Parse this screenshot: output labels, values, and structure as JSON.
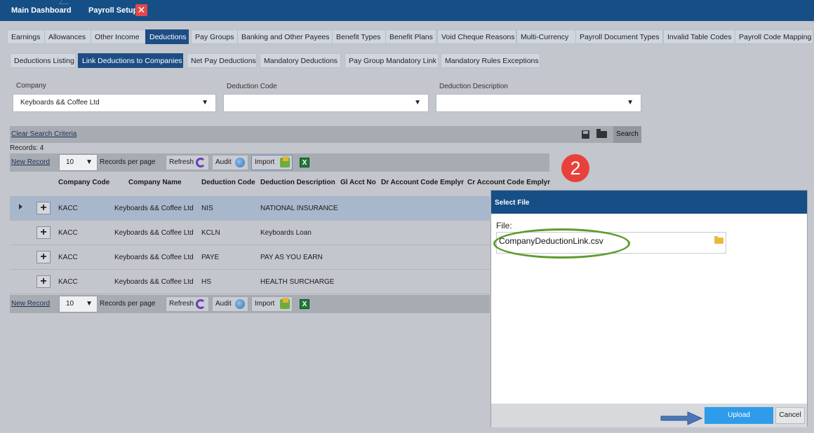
{
  "top_tabs": {
    "main": "Main Dashboard",
    "payroll": "Payroll Setup",
    "close": "✕"
  },
  "tabs_level1": [
    "Earnings",
    "Allowances",
    "Other Income",
    "Deductions",
    "Pay Groups",
    "Banking and Other Payees",
    "Benefit Types",
    "Benefit Plans",
    "Void Cheque Reasons",
    "Multi-Currency",
    "Payroll Document Types",
    "Invalid Table Codes",
    "Payroll Code Mapping"
  ],
  "tabs_level1_active": "Deductions",
  "tabs_level2": [
    "Deductions Listing",
    "Link Deductions to Companies",
    "Net Pay Deductions",
    "Mandatory Deductions",
    "Pay Group Mandatory Link",
    "Mandatory Rules Exceptions"
  ],
  "tabs_level2_active": "Link Deductions to Companies",
  "filters": {
    "company_label": "Company",
    "company_value": "Keyboards && Coffee Ltd",
    "deduction_code_label": "Deduction Code",
    "deduction_code_value": "",
    "deduction_desc_label": "Deduction Description",
    "deduction_desc_value": ""
  },
  "search_bar": {
    "clear": "Clear Search Criteria",
    "search": "Search"
  },
  "records": "Records:  4",
  "toolbar": {
    "new_record": "New Record",
    "per_page_value": "10",
    "per_page_label": "Records per page",
    "refresh": "Refresh",
    "audit": "Audit",
    "import": "Import"
  },
  "columns": [
    "Company Code",
    "Company Name",
    "Deduction Code",
    "Deduction Description",
    "Gl Acct No",
    "Dr Account Code Emplyr",
    "Cr Account Code Emplyr"
  ],
  "rows": [
    {
      "code": "KACC",
      "name": "Keyboards && Coffee Ltd",
      "ded": "NIS",
      "desc": "NATIONAL INSURANCE"
    },
    {
      "code": "KACC",
      "name": "Keyboards && Coffee Ltd",
      "ded": "KCLN",
      "desc": "Keyboards Loan"
    },
    {
      "code": "KACC",
      "name": "Keyboards && Coffee Ltd",
      "ded": "PAYE",
      "desc": "PAY AS YOU EARN"
    },
    {
      "code": "KACC",
      "name": "Keyboards && Coffee Ltd",
      "ded": "HS",
      "desc": "HEALTH SURCHARGE"
    }
  ],
  "step_badge": "2",
  "dialog": {
    "title": "Select File",
    "file_label": "File:",
    "file_value": "CompanyDeductionLink.csv",
    "upload": "Upload",
    "cancel": "Cancel"
  },
  "colors": {
    "header_blue": "#164f86",
    "active_tab": "#1d4d84",
    "upload_blue": "#2e9cea",
    "badge_red": "#e8413c",
    "highlight_green": "#5e9b2f"
  },
  "icons": [
    "close-icon",
    "save-icon",
    "folder-icon",
    "refresh-icon",
    "audit-icon",
    "import-icon",
    "excel-icon",
    "expand-arrow-icon",
    "plus-icon",
    "arrow-pointer-icon"
  ]
}
